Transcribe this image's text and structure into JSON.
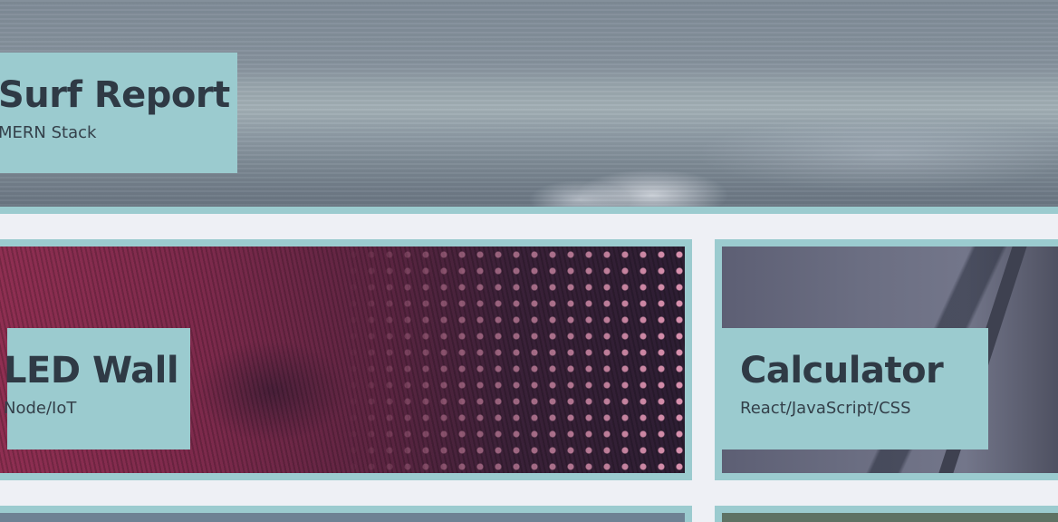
{
  "projects": [
    {
      "title": "Surf Report",
      "subtitle": "MERN Stack"
    },
    {
      "title": "LED Wall",
      "subtitle": "Node/IoT"
    },
    {
      "title": "Calculator",
      "subtitle": "React/JavaScript/CSS"
    }
  ],
  "colors": {
    "accent": "#9bcbcf",
    "page_background": "#eef0f5",
    "label_text": "#2f3a45"
  }
}
